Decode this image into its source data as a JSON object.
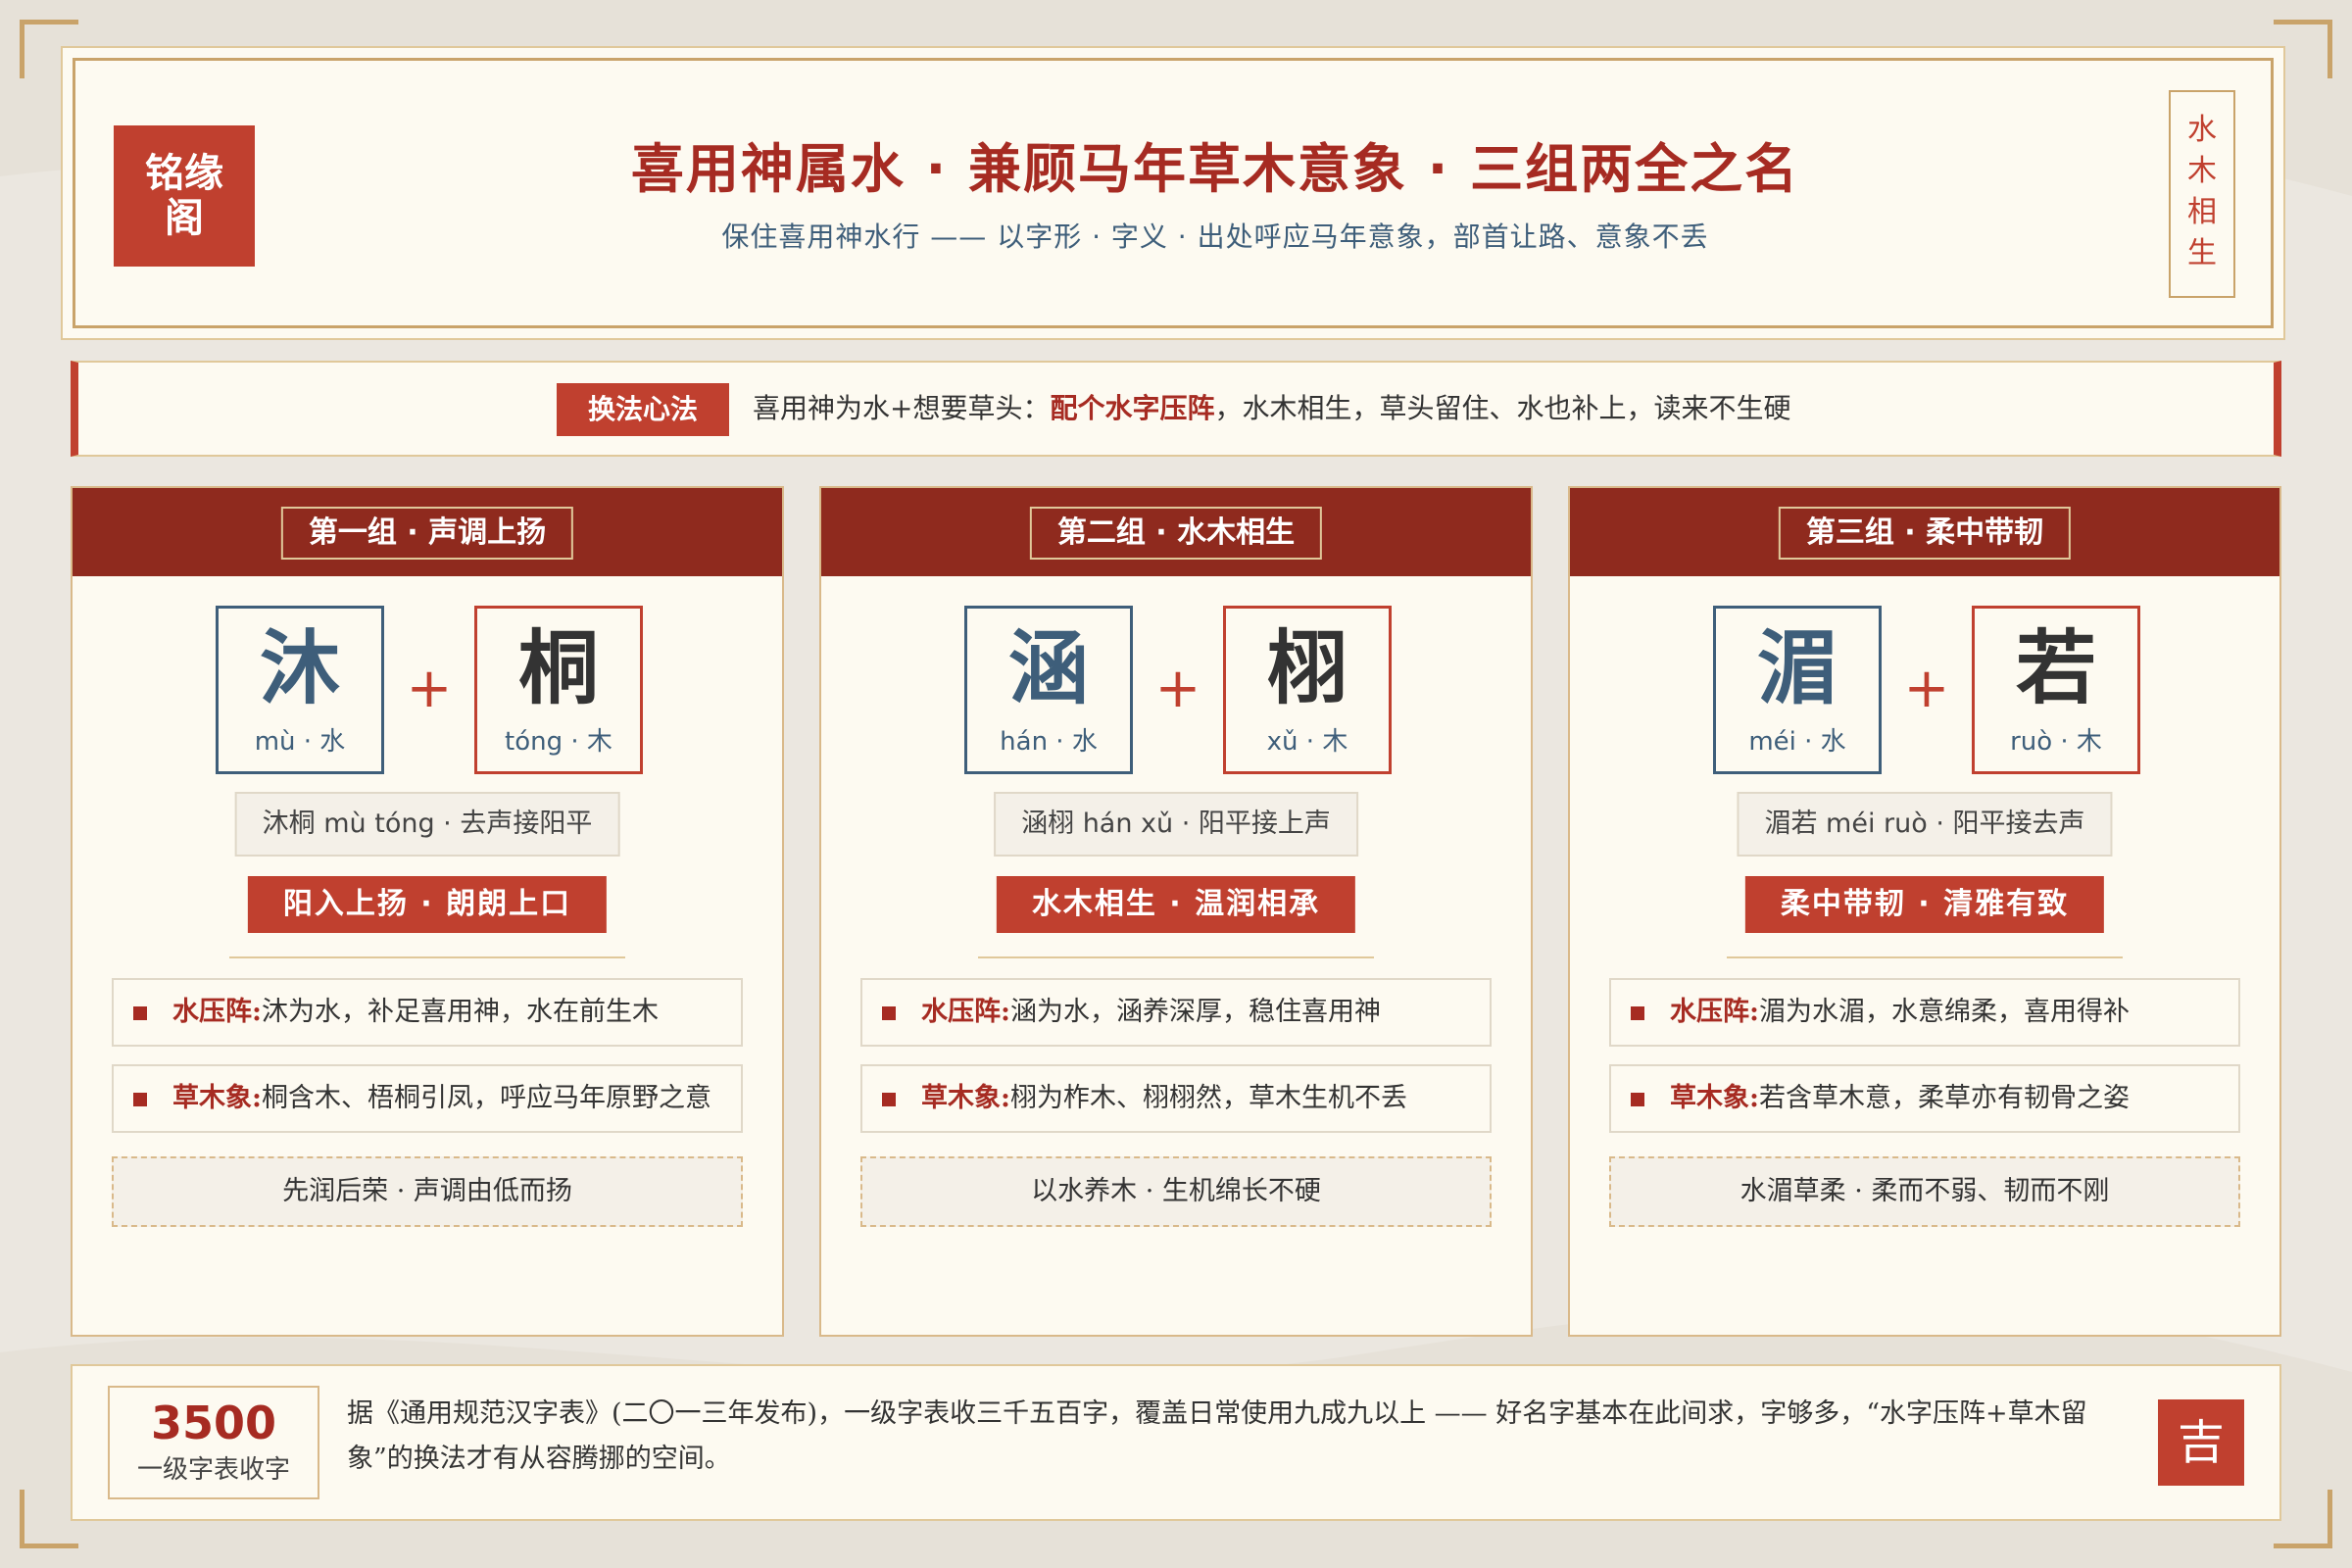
{
  "brand": {
    "logo_line1": "铭缘",
    "logo_line2": "阁"
  },
  "header": {
    "title": "喜用神属水 · 兼顾马年草木意象 · 三组两全之名",
    "subtitle": "保住喜用神水行 —— 以字形 · 字义 · 出处呼应马年意象，部首让路、意象不丢",
    "seal": [
      "水",
      "木",
      "相",
      "生"
    ]
  },
  "rule": {
    "tag": "换法心法",
    "text_before": "喜用神为水+想要草头：",
    "highlight": "配个水字压阵",
    "text_after": "，水木相生，草头留住、水也补上，读来不生硬"
  },
  "groups": [
    {
      "title": "第一组 · 声调上扬",
      "char1": {
        "char": "沐",
        "pinyin": "mù · 水"
      },
      "char2": {
        "char": "桐",
        "pinyin": "tóng · 木"
      },
      "name_line": "沐桐 mù tóng · 去声接阳平",
      "motto": "阳入上扬 · 朗朗上口",
      "water_label": "水压阵:",
      "water_text": "沐为水，补足喜用神，水在前生木",
      "wood_label": "草木象:",
      "wood_text": "桐含木、梧桐引凤，呼应马年原野之意",
      "note": "先润后荣 · 声调由低而扬"
    },
    {
      "title": "第二组 · 水木相生",
      "char1": {
        "char": "涵",
        "pinyin": "hán · 水"
      },
      "char2": {
        "char": "栩",
        "pinyin": "xǔ · 木"
      },
      "name_line": "涵栩 hán xǔ · 阳平接上声",
      "motto": "水木相生 · 温润相承",
      "water_label": "水压阵:",
      "water_text": "涵为水，涵养深厚，稳住喜用神",
      "wood_label": "草木象:",
      "wood_text": "栩为柞木、栩栩然，草木生机不丢",
      "note": "以水养木 · 生机绵长不硬"
    },
    {
      "title": "第三组 · 柔中带韧",
      "char1": {
        "char": "湄",
        "pinyin": "méi · 水"
      },
      "char2": {
        "char": "若",
        "pinyin": "ruò · 木"
      },
      "name_line": "湄若 méi ruò · 阳平接去声",
      "motto": "柔中带韧 · 清雅有致",
      "water_label": "水压阵:",
      "water_text": "湄为水湄，水意绵柔，喜用得补",
      "wood_label": "草木象:",
      "wood_text": "若含草木意，柔草亦有韧骨之姿",
      "note": "水湄草柔 · 柔而不弱、韧而不刚"
    }
  ],
  "footer": {
    "stat_num": "3500",
    "stat_label": "一级字表收字",
    "text": "据《通用规范汉字表》(二〇一三年发布)，一级字表收三千五百字，覆盖日常使用九成九以上 —— 好名字基本在此间求，字够多，“水字压阵+草木留象”的换法才有从容腾挪的空间。",
    "lucky": "吉"
  },
  "colors": {
    "accent_red": "#c0402f",
    "dark_red": "#8f2a1e",
    "water_blue": "#3e5e7a",
    "gold": "#c9a36a",
    "paper": "#fdfaf1"
  }
}
